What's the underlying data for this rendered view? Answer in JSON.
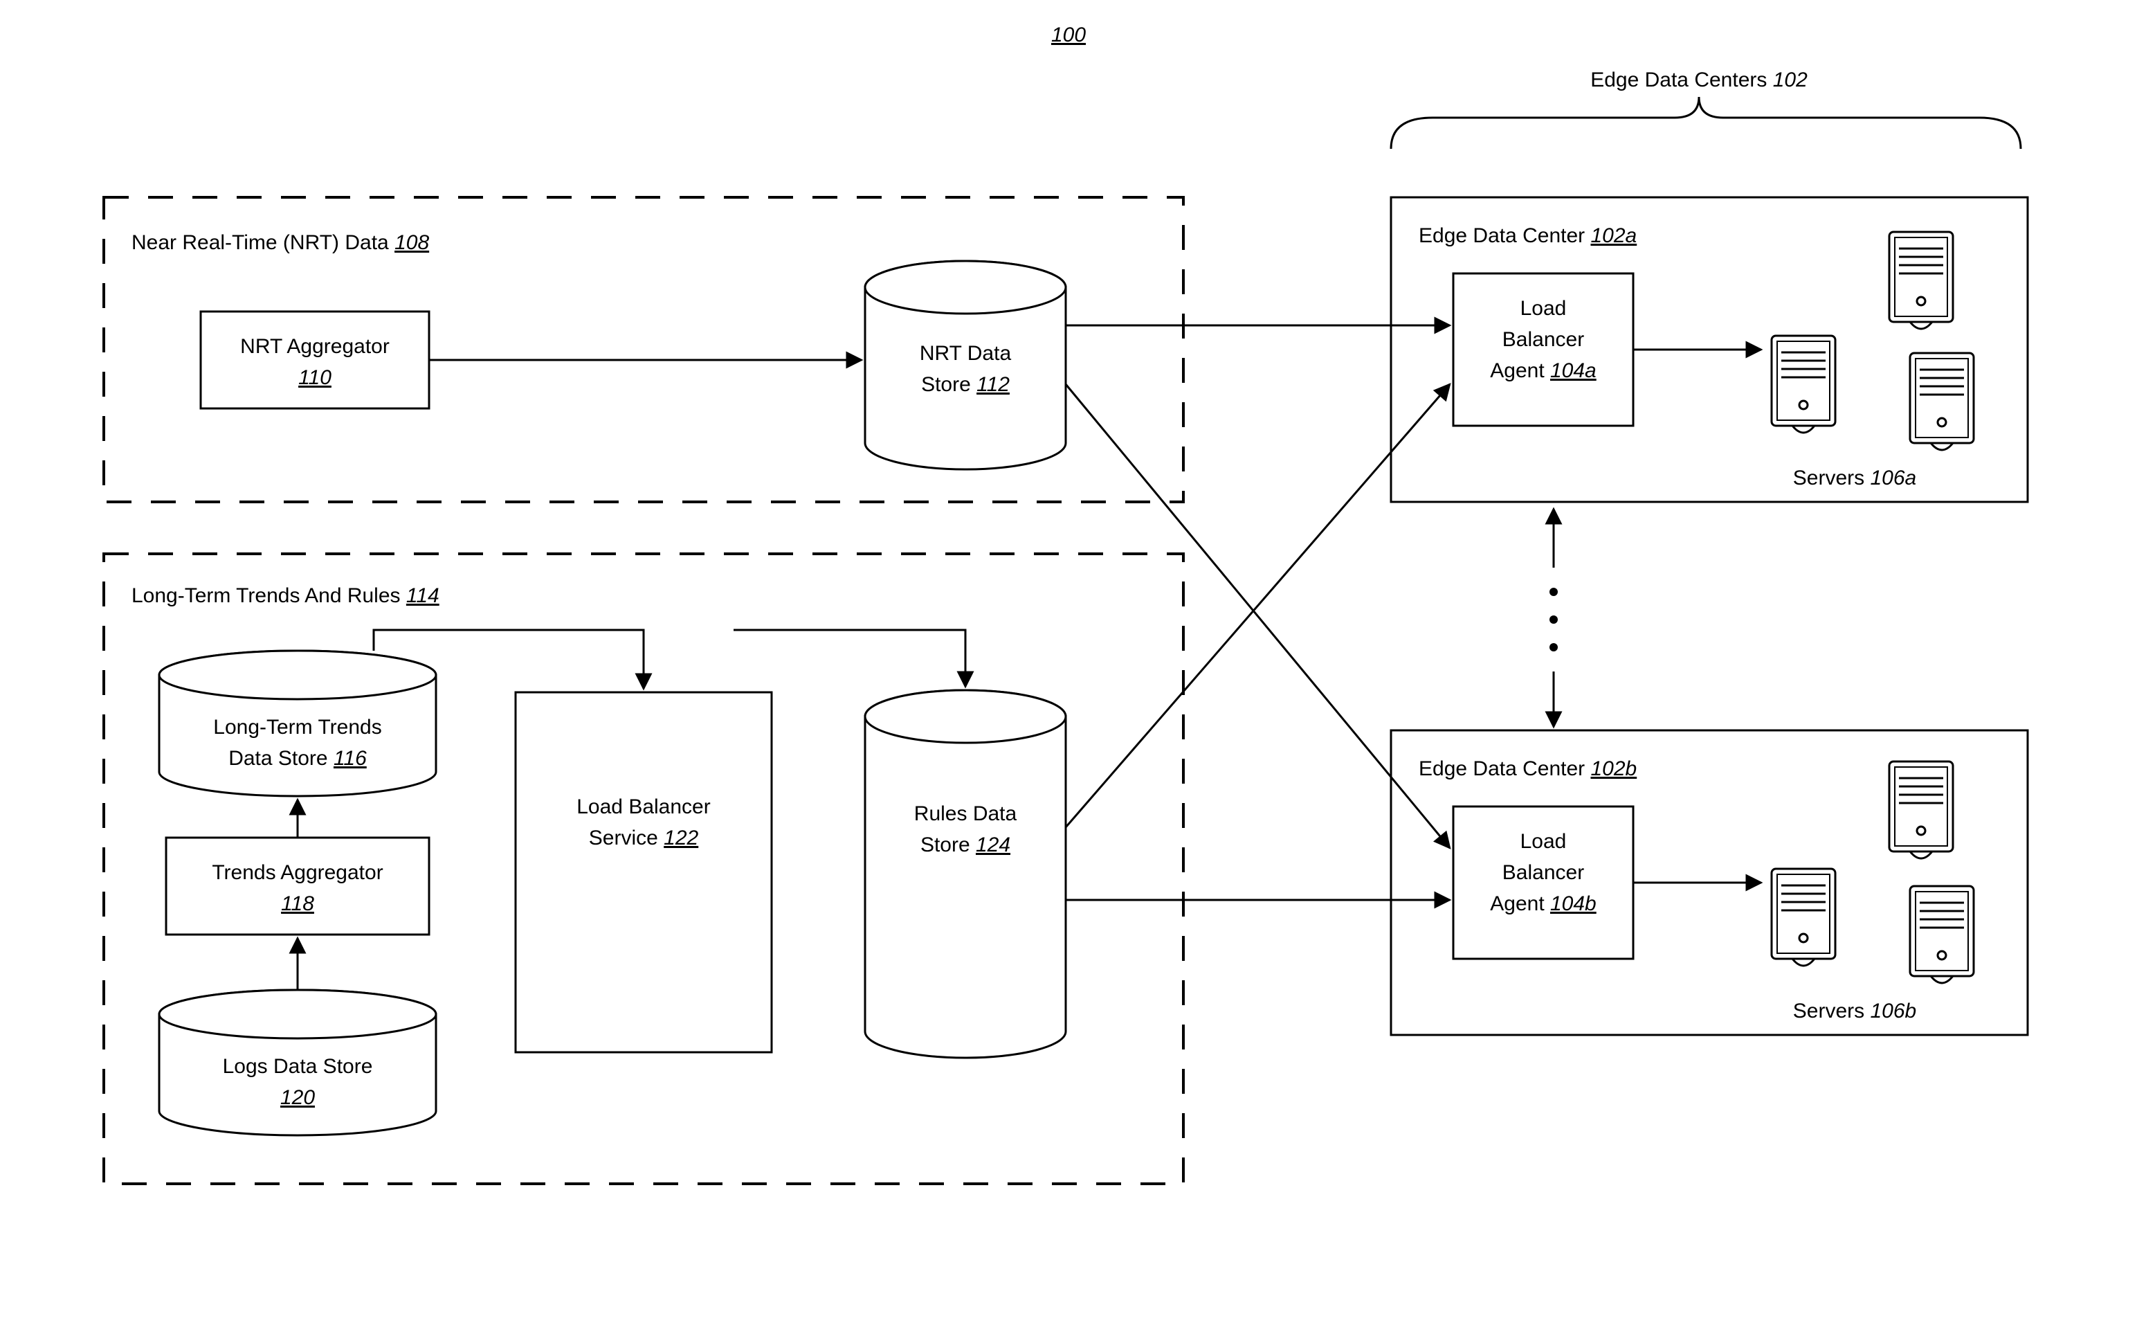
{
  "figureNumber": "100",
  "nrtSection": {
    "title_prefix": "Near Real-Time (NRT) Data  ",
    "title_num": "108",
    "aggregator_label": "NRT Aggregator",
    "aggregator_num": "110",
    "store_label1": "NRT Data",
    "store_label2": "Store  ",
    "store_num": "112"
  },
  "ltSection": {
    "title_prefix": "Long-Term Trends And Rules  ",
    "title_num": "114",
    "trendsStore_l1": "Long-Term Trends",
    "trendsStore_l2_prefix": "Data Store  ",
    "trendsStore_num": "116",
    "trendsAgg_l1": "Trends Aggregator",
    "trendsAgg_num": "118",
    "logsStore_l1": "Logs Data Store",
    "logsStore_num": "120",
    "lbService_l1": "Load Balancer",
    "lbService_l2_prefix": "Service  ",
    "lbService_num": "122",
    "rulesStore_l1": "Rules Data",
    "rulesStore_l2_prefix": "Store  ",
    "rulesStore_num": "124"
  },
  "edge": {
    "group_title_prefix": "Edge Data Centers ",
    "group_title_num": "102",
    "dcA_title_prefix": "Edge Data Center  ",
    "dcA_title_num": "102a",
    "dcA_agent_l1": "Load",
    "dcA_agent_l2": "Balancer",
    "dcA_agent_l3_prefix": "Agent  ",
    "dcA_agent_num": "104a",
    "dcA_servers_prefix": "Servers ",
    "dcA_servers_num": "106a",
    "dcB_title_prefix": "Edge Data Center  ",
    "dcB_title_num": "102b",
    "dcB_agent_l1": "Load",
    "dcB_agent_l2": "Balancer",
    "dcB_agent_l3_prefix": "Agent  ",
    "dcB_agent_num": "104b",
    "dcB_servers_prefix": "Servers ",
    "dcB_servers_num": "106b"
  }
}
